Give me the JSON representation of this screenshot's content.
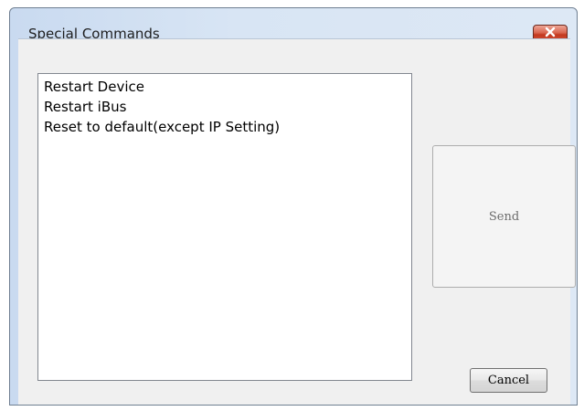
{
  "dialog": {
    "title": "Special Commands",
    "close_icon": "close-icon"
  },
  "commands": {
    "items": [
      {
        "label": "Restart Device"
      },
      {
        "label": "Restart iBus"
      },
      {
        "label": "Reset to default(except IP Setting)"
      }
    ]
  },
  "buttons": {
    "send_label": "Send",
    "cancel_label": "Cancel"
  },
  "colors": {
    "close_button": "#c8432b",
    "client_background": "#f0f0f0",
    "frame": "#d8e5f4"
  }
}
